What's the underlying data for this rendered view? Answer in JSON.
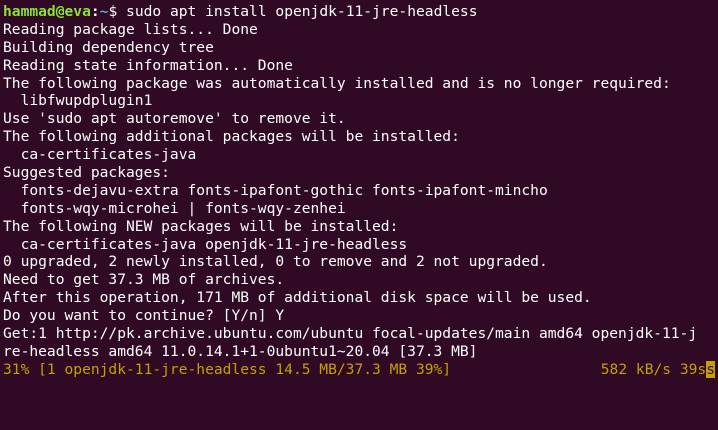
{
  "terminal": {
    "prompt": {
      "user": "hammad@eva",
      "separator": ":",
      "path": "~",
      "symbol": "$ ",
      "command": "sudo apt install openjdk-11-jre-headless"
    },
    "output_lines": [
      "Reading package lists... Done",
      "Building dependency tree",
      "Reading state information... Done",
      "The following package was automatically installed and is no longer required:",
      "  libfwupdplugin1",
      "Use 'sudo apt autoremove' to remove it.",
      "The following additional packages will be installed:",
      "  ca-certificates-java",
      "Suggested packages:",
      "  fonts-dejavu-extra fonts-ipafont-gothic fonts-ipafont-mincho",
      "  fonts-wqy-microhei | fonts-wqy-zenhei",
      "The following NEW packages will be installed:",
      "  ca-certificates-java openjdk-11-jre-headless",
      "0 upgraded, 2 newly installed, 0 to remove and 2 not upgraded.",
      "Need to get 37.3 MB of archives.",
      "After this operation, 171 MB of additional disk space will be used.",
      "Do you want to continue? [Y/n] Y",
      "Get:1 http://pk.archive.ubuntu.com/ubuntu focal-updates/main amd64 openjdk-11-j",
      "re-headless amd64 11.0.14.1+1-0ubuntu1~20.04 [37.3 MB]"
    ],
    "progress": {
      "left": "31% [1 openjdk-11-jre-headless 14.5 MB/37.3 MB 39%]",
      "right": "582 kB/s 39s",
      "cursor_char": "s"
    },
    "colors": {
      "background": "#300a24",
      "text": "#ffffff",
      "user": "#8ae234",
      "path": "#729fcf",
      "progress": "#c4a000"
    }
  }
}
